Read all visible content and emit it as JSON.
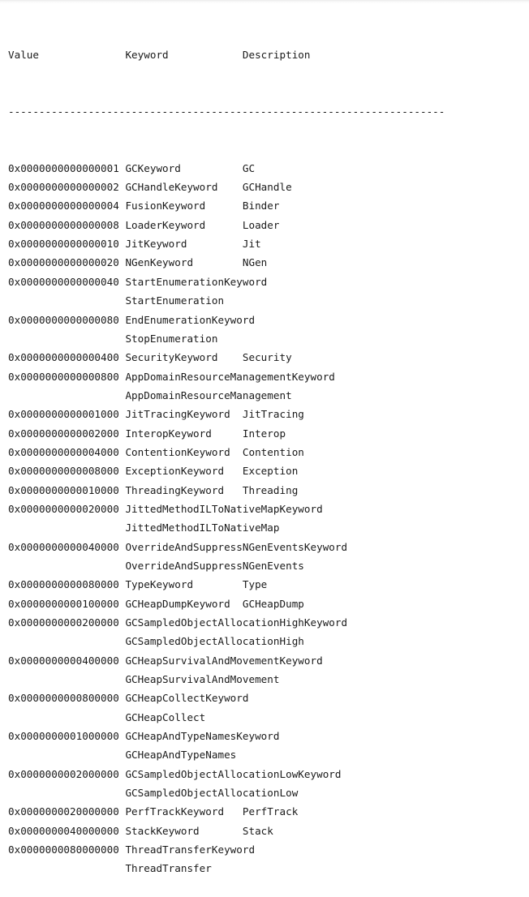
{
  "table": {
    "headers": {
      "value": "Value",
      "keyword": "Keyword",
      "description": "Description"
    },
    "separator": "-----------------------------------------------------------------------",
    "columns": {
      "value_width": 19,
      "keyword_width": 19
    },
    "rows": [
      {
        "value": "0x0000000000000001",
        "keyword": "GCKeyword",
        "description": "GC"
      },
      {
        "value": "0x0000000000000002",
        "keyword": "GCHandleKeyword",
        "description": "GCHandle"
      },
      {
        "value": "0x0000000000000004",
        "keyword": "FusionKeyword",
        "description": "Binder"
      },
      {
        "value": "0x0000000000000008",
        "keyword": "LoaderKeyword",
        "description": "Loader"
      },
      {
        "value": "0x0000000000000010",
        "keyword": "JitKeyword",
        "description": "Jit"
      },
      {
        "value": "0x0000000000000020",
        "keyword": "NGenKeyword",
        "description": "NGen"
      },
      {
        "value": "0x0000000000000040",
        "keyword": "StartEnumerationKeyword",
        "description": "StartEnumeration"
      },
      {
        "value": "0x0000000000000080",
        "keyword": "EndEnumerationKeyword",
        "description": "StopEnumeration"
      },
      {
        "value": "0x0000000000000400",
        "keyword": "SecurityKeyword",
        "description": "Security"
      },
      {
        "value": "0x0000000000000800",
        "keyword": "AppDomainResourceManagementKeyword",
        "description": "AppDomainResourceManagement"
      },
      {
        "value": "0x0000000000001000",
        "keyword": "JitTracingKeyword",
        "description": "JitTracing"
      },
      {
        "value": "0x0000000000002000",
        "keyword": "InteropKeyword",
        "description": "Interop"
      },
      {
        "value": "0x0000000000004000",
        "keyword": "ContentionKeyword",
        "description": "Contention"
      },
      {
        "value": "0x0000000000008000",
        "keyword": "ExceptionKeyword",
        "description": "Exception"
      },
      {
        "value": "0x0000000000010000",
        "keyword": "ThreadingKeyword",
        "description": "Threading"
      },
      {
        "value": "0x0000000000020000",
        "keyword": "JittedMethodILToNativeMapKeyword",
        "description": "JittedMethodILToNativeMap"
      },
      {
        "value": "0x0000000000040000",
        "keyword": "OverrideAndSuppressNGenEventsKeyword",
        "description": "OverrideAndSuppressNGenEvents"
      },
      {
        "value": "0x0000000000080000",
        "keyword": "TypeKeyword",
        "description": "Type"
      },
      {
        "value": "0x0000000000100000",
        "keyword": "GCHeapDumpKeyword",
        "description": "GCHeapDump"
      },
      {
        "value": "0x0000000000200000",
        "keyword": "GCSampledObjectAllocationHighKeyword",
        "description": "GCSampledObjectAllocationHigh"
      },
      {
        "value": "0x0000000000400000",
        "keyword": "GCHeapSurvivalAndMovementKeyword",
        "description": "GCHeapSurvivalAndMovement"
      },
      {
        "value": "0x0000000000800000",
        "keyword": "GCHeapCollectKeyword",
        "description": "GCHeapCollect"
      },
      {
        "value": "0x0000000001000000",
        "keyword": "GCHeapAndTypeNamesKeyword",
        "description": "GCHeapAndTypeNames"
      },
      {
        "value": "0x0000000002000000",
        "keyword": "GCSampledObjectAllocationLowKeyword",
        "description": "GCSampledObjectAllocationLow"
      },
      {
        "value": "0x0000000020000000",
        "keyword": "PerfTrackKeyword",
        "description": "PerfTrack"
      },
      {
        "value": "0x0000000040000000",
        "keyword": "StackKeyword",
        "description": "Stack"
      },
      {
        "value": "0x0000000080000000",
        "keyword": "ThreadTransferKeyword",
        "description": "ThreadTransfer"
      }
    ]
  }
}
